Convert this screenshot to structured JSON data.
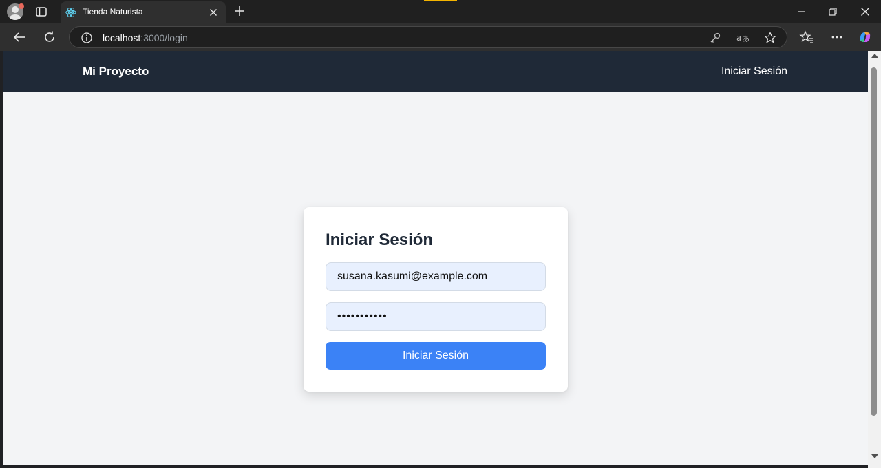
{
  "browser": {
    "tab": {
      "title": "Tienda Naturista",
      "favicon": "react-icon"
    },
    "address": {
      "host": "localhost",
      "path": ":3000/login"
    },
    "icons": {
      "back": "back-arrow-icon",
      "reload": "reload-icon",
      "site_info": "info-icon",
      "password": "key-icon",
      "translate": "translate-icon",
      "favorite": "star-icon",
      "favorites": "favorites-icon",
      "menu": "more-icon",
      "copilot": "copilot-icon"
    },
    "accent_color": "#f4b400"
  },
  "navbar": {
    "brand": "Mi Proyecto",
    "login_link": "Iniciar Sesión",
    "background": "#1f2937"
  },
  "login_form": {
    "title": "Iniciar Sesión",
    "email_value": "susana.kasumi@example.com",
    "password_value": "•••••••••••",
    "submit_label": "Iniciar Sesión",
    "button_color": "#3b82f6"
  }
}
